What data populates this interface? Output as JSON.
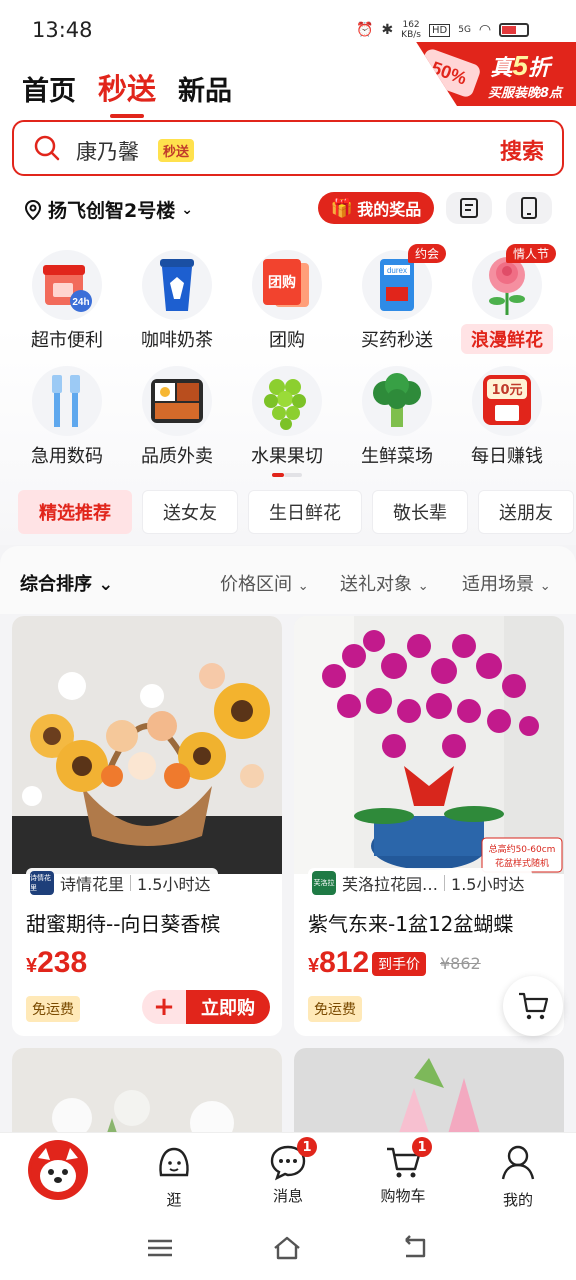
{
  "status": {
    "time": "13:48",
    "net_speed": "162\nKB/s",
    "net_type": "5G"
  },
  "promo": {
    "tag": "50%",
    "main_prefix": "真",
    "main_number": "5",
    "main_suffix": "折",
    "sub": "买服装晚8点"
  },
  "nav": {
    "tabs": [
      "首页",
      "秒送",
      "新品"
    ],
    "active": "秒送"
  },
  "search": {
    "query": "康乃馨",
    "badge": "秒送",
    "button": "搜索"
  },
  "location": {
    "address": "扬飞创智2号楼",
    "prize_button": "我的奖品"
  },
  "categories": [
    {
      "label": "超市便利",
      "icon": "supermarket-icon"
    },
    {
      "label": "咖啡奶茶",
      "icon": "coffee-cup-icon"
    },
    {
      "label": "团购",
      "icon": "group-buy-icon"
    },
    {
      "label": "买药秒送",
      "icon": "medicine-icon",
      "badge": "约会"
    },
    {
      "label": "浪漫鲜花",
      "icon": "rose-icon",
      "badge": "情人节"
    },
    {
      "label": "急用数码",
      "icon": "cable-icon"
    },
    {
      "label": "品质外卖",
      "icon": "bento-icon"
    },
    {
      "label": "水果果切",
      "icon": "grapes-icon"
    },
    {
      "label": "生鲜菜场",
      "icon": "broccoli-icon"
    },
    {
      "label": "每日赚钱",
      "icon": "money-icon",
      "badge_inline": "10元"
    }
  ],
  "chips": [
    "精选推荐",
    "送女友",
    "生日鲜花",
    "敬长辈",
    "送朋友"
  ],
  "sort": {
    "main": "综合排序",
    "filters": [
      "价格区间",
      "送礼对象",
      "适用场景"
    ]
  },
  "products": [
    {
      "shop": "诗情花里",
      "shop_logo": "诗情花里",
      "delivery": "1.5小时达",
      "title": "甜蜜期待--向日葵香槟",
      "currency": "¥",
      "price": "238",
      "free_shipping": "免运费",
      "buy_plus": "+",
      "buy_label": "立即购"
    },
    {
      "shop": "芙洛拉花园…",
      "shop_logo": "芙洛拉",
      "delivery": "1.5小时达",
      "title": "紫气东来-1盆12盆蝴蝶",
      "currency": "¥",
      "price": "812",
      "hand_price_label": "到手价",
      "old_price": "¥862",
      "free_shipping": "免运费",
      "image_note": "总高约50-60cm\n花盆样式随机"
    }
  ],
  "bottom_nav": [
    {
      "label": "",
      "icon": "jd-mascot-icon"
    },
    {
      "label": "逛",
      "icon": "browse-icon"
    },
    {
      "label": "消息",
      "icon": "message-icon",
      "badge": "1"
    },
    {
      "label": "购物车",
      "icon": "cart-icon",
      "badge": "1"
    },
    {
      "label": "我的",
      "icon": "profile-icon"
    }
  ],
  "colors": {
    "brand": "#e1251b",
    "highlight_bg": "#ffe3e5",
    "badge_yellow": "#ffe14d"
  }
}
